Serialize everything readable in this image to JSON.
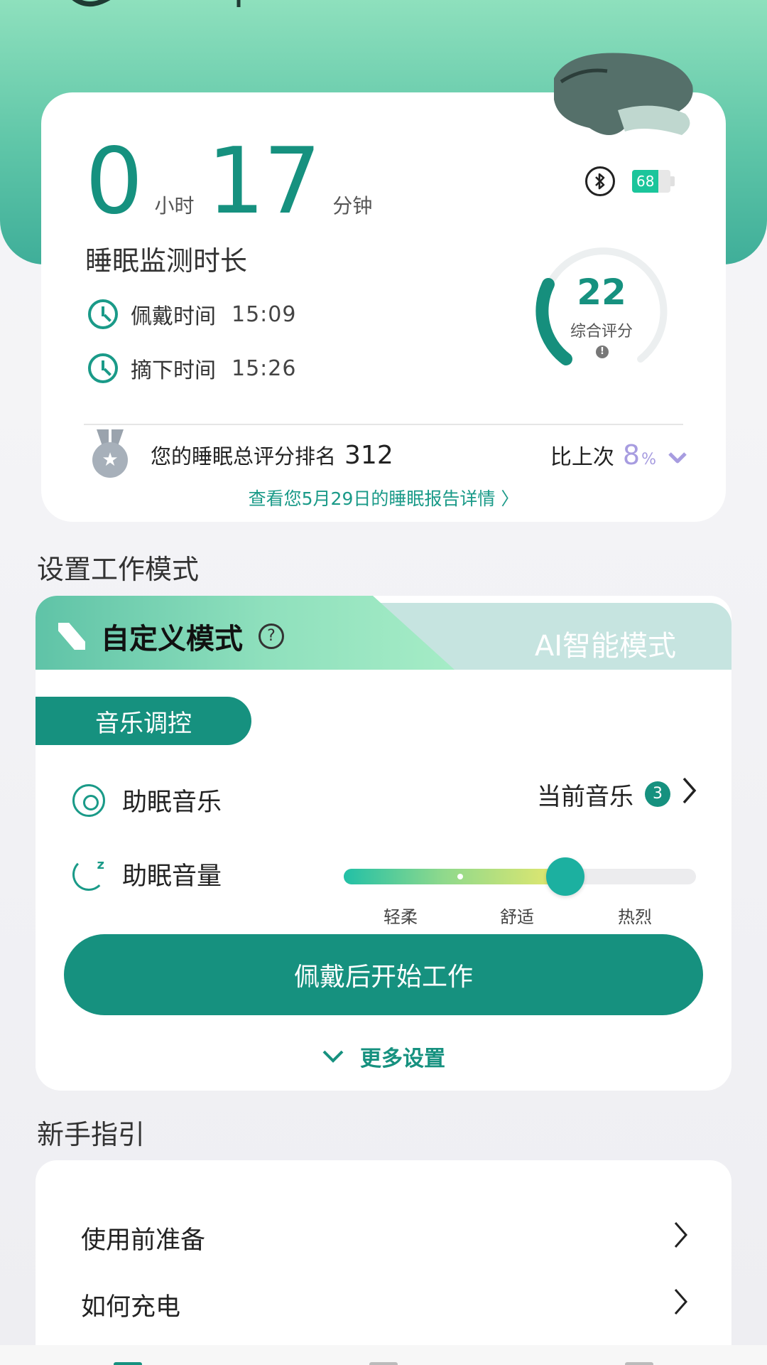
{
  "hero": {
    "hours": "0",
    "hours_unit": "小时",
    "minutes": "17",
    "minutes_unit": "分钟",
    "duration_label": "睡眠监测时长",
    "battery_level": "68",
    "wear_label": "佩戴时间",
    "wear_time": "15:09",
    "remove_label": "摘下时间",
    "remove_time": "15:26",
    "score": "22",
    "score_label": "综合评分",
    "score_info": "!",
    "rank_label": "您的睡眠总评分排名",
    "rank_value": "312",
    "compare_label": "比上次",
    "compare_value": "8",
    "compare_unit": "%",
    "report_link": "查看您5月29日的睡眠报告详情 〉"
  },
  "mode": {
    "section_title": "设置工作模式",
    "custom_tab": "自定义模式",
    "help": "?",
    "ai_tab": "AI智能模式",
    "music_pill": "音乐调控",
    "sleep_music_label": "助眠音乐",
    "current_music_label": "当前音乐",
    "current_music_count": "3",
    "volume_label": "助眠音量",
    "volume_level": 0.63,
    "volume_ticks": [
      "轻柔",
      "舒适",
      "热烈"
    ],
    "start_button": "佩戴后开始工作",
    "more_settings": "更多设置"
  },
  "guide": {
    "section_title": "新手指引",
    "items": [
      "使用前准备",
      "如何充电"
    ]
  },
  "colors": {
    "accent": "#16917f",
    "header_top": "#8ee0bd",
    "compare": "#a79ce0"
  },
  "icons": {
    "bluetooth": "bluetooth-icon",
    "clock": "clock-icon",
    "medal": "medal-icon",
    "disc": "music-disc-icon",
    "moon": "moon-sleep-icon",
    "chevron": "chevron-right-icon"
  }
}
